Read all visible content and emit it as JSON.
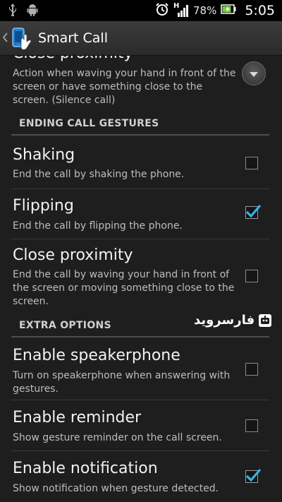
{
  "status_bar": {
    "left_icons": [
      "usb-icon",
      "android-icon"
    ],
    "alarm_icon": "alarm-clock-icon",
    "network_label": "H",
    "battery_percent": "78%",
    "time": "5:05"
  },
  "action_bar": {
    "title": "Smart Call",
    "up_icon": "back-chevron-icon"
  },
  "partial_item": {
    "title": "Close proximity",
    "summary": "Action when waving your hand in front of the screen or have something close to the screen. (Silence call)",
    "control": "dropdown-icon"
  },
  "sections": [
    {
      "header": "ENDING CALL GESTURES",
      "items": [
        {
          "title": "Shaking",
          "summary": "End the call by shaking the phone.",
          "checked": false
        },
        {
          "title": "Flipping",
          "summary": "End the call by flipping the phone.",
          "checked": true
        },
        {
          "title": "Close proximity",
          "summary": "End the call by waving your hand in front of the screen or moving something close to the screen.",
          "checked": false
        }
      ]
    },
    {
      "header": "EXTRA OPTIONS",
      "items": [
        {
          "title": "Enable speakerphone",
          "summary": "Turn on speakerphone when answering with gestures.",
          "checked": false
        },
        {
          "title": "Enable reminder",
          "summary": "Show gesture reminder on the call screen.",
          "checked": false
        },
        {
          "title": "Enable notification",
          "summary": "Show notification when gesture detected.",
          "checked": true
        }
      ]
    }
  ],
  "watermark": {
    "text": "فارسروید",
    "icon": "farsroid-logo-icon"
  },
  "colors": {
    "accent_check": "#33b5e5",
    "background": "#1e1e1e",
    "battery_green": "#7ac943"
  }
}
